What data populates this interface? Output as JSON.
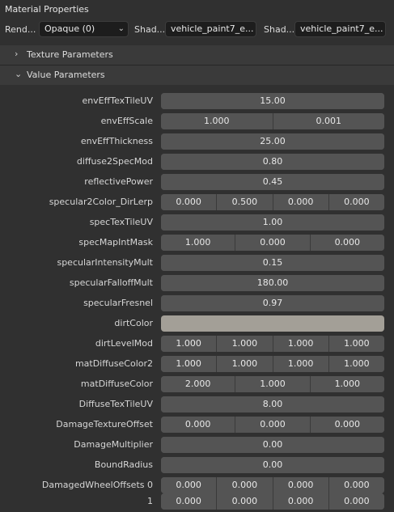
{
  "panel_title": "Material Properties",
  "top": {
    "render_label": "Rend...",
    "render_value": "Opaque (0)",
    "shader1_label": "Shad...",
    "shader1_value": "vehicle_paint7_e...",
    "shader2_label": "Shad...",
    "shader2_value": "vehicle_paint7_e..."
  },
  "sections": {
    "texture": "Texture Parameters",
    "value": "Value Parameters"
  },
  "colors": {
    "dirtColor": "#a39f97",
    "field": "#545454",
    "background": "#303030"
  },
  "rows": [
    {
      "label": "envEffTexTileUV",
      "values": [
        "15.00"
      ]
    },
    {
      "label": "envEffScale",
      "values": [
        "1.000",
        "0.001"
      ]
    },
    {
      "label": "envEffThickness",
      "values": [
        "25.00"
      ]
    },
    {
      "label": "diffuse2SpecMod",
      "values": [
        "0.80"
      ]
    },
    {
      "label": "reflectivePower",
      "values": [
        "0.45"
      ]
    },
    {
      "label": "specular2Color_DirLerp",
      "values": [
        "0.000",
        "0.500",
        "0.000",
        "0.000"
      ]
    },
    {
      "label": "specTexTileUV",
      "values": [
        "1.00"
      ]
    },
    {
      "label": "specMapIntMask",
      "values": [
        "1.000",
        "0.000",
        "0.000"
      ]
    },
    {
      "label": "specularIntensityMult",
      "values": [
        "0.15"
      ]
    },
    {
      "label": "specularFalloffMult",
      "values": [
        "180.00"
      ]
    },
    {
      "label": "specularFresnel",
      "values": [
        "0.97"
      ]
    },
    {
      "label": "dirtColor",
      "color": "#a39f97"
    },
    {
      "label": "dirtLevelMod",
      "values": [
        "1.000",
        "1.000",
        "1.000",
        "1.000"
      ]
    },
    {
      "label": "matDiffuseColor2",
      "values": [
        "1.000",
        "1.000",
        "1.000",
        "1.000"
      ]
    },
    {
      "label": "matDiffuseColor",
      "values": [
        "2.000",
        "1.000",
        "1.000"
      ]
    },
    {
      "label": "DiffuseTexTileUV",
      "values": [
        "8.00"
      ]
    },
    {
      "label": "DamageTextureOffset",
      "values": [
        "0.000",
        "0.000",
        "0.000"
      ]
    },
    {
      "label": "DamageMultiplier",
      "values": [
        "0.00"
      ]
    },
    {
      "label": "BoundRadius",
      "values": [
        "0.00"
      ]
    },
    {
      "label": "DamagedWheelOffsets 0",
      "values": [
        "0.000",
        "0.000",
        "0.000",
        "0.000"
      ]
    },
    {
      "label": "1",
      "values": [
        "0.000",
        "0.000",
        "0.000",
        "0.000"
      ]
    }
  ]
}
